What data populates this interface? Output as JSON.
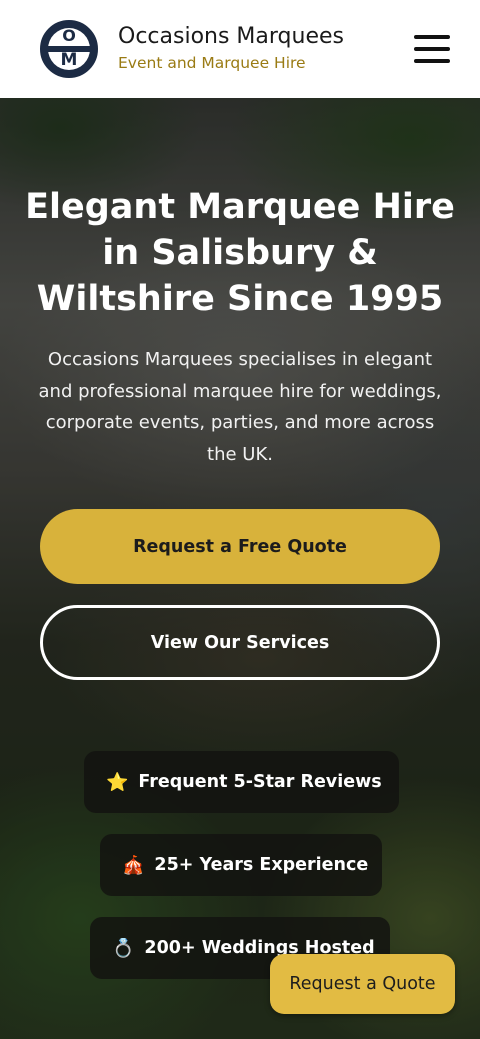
{
  "header": {
    "logo_letters": [
      "O",
      "M"
    ],
    "brand_name": "Occasions Marquees",
    "tagline": "Event and Marquee Hire",
    "menu_icon": "hamburger-menu-icon"
  },
  "hero": {
    "title": "Elegant Marquee Hire in Salisbury & Wiltshire Since 1995",
    "description": "Occasions Marquees specialises in elegant and professional marquee hire for weddings, corporate events, parties, and more across the UK.",
    "primary_cta": "Request a Free Quote",
    "secondary_cta": "View Our Services"
  },
  "badges": [
    {
      "icon": "star-icon",
      "glyph": "⭐",
      "label": "Frequent 5-Star Reviews"
    },
    {
      "icon": "circus-tent-icon",
      "glyph": "🎪",
      "label": "25+ Years Experience"
    },
    {
      "icon": "ring-icon",
      "glyph": "💍",
      "label": "200+ Weddings Hosted"
    }
  ],
  "floating_button": {
    "label": "Request a Quote"
  },
  "colors": {
    "accent_gold": "#d8b23b",
    "brand_navy": "#1c2b44",
    "tagline_gold": "#9a7b14"
  }
}
